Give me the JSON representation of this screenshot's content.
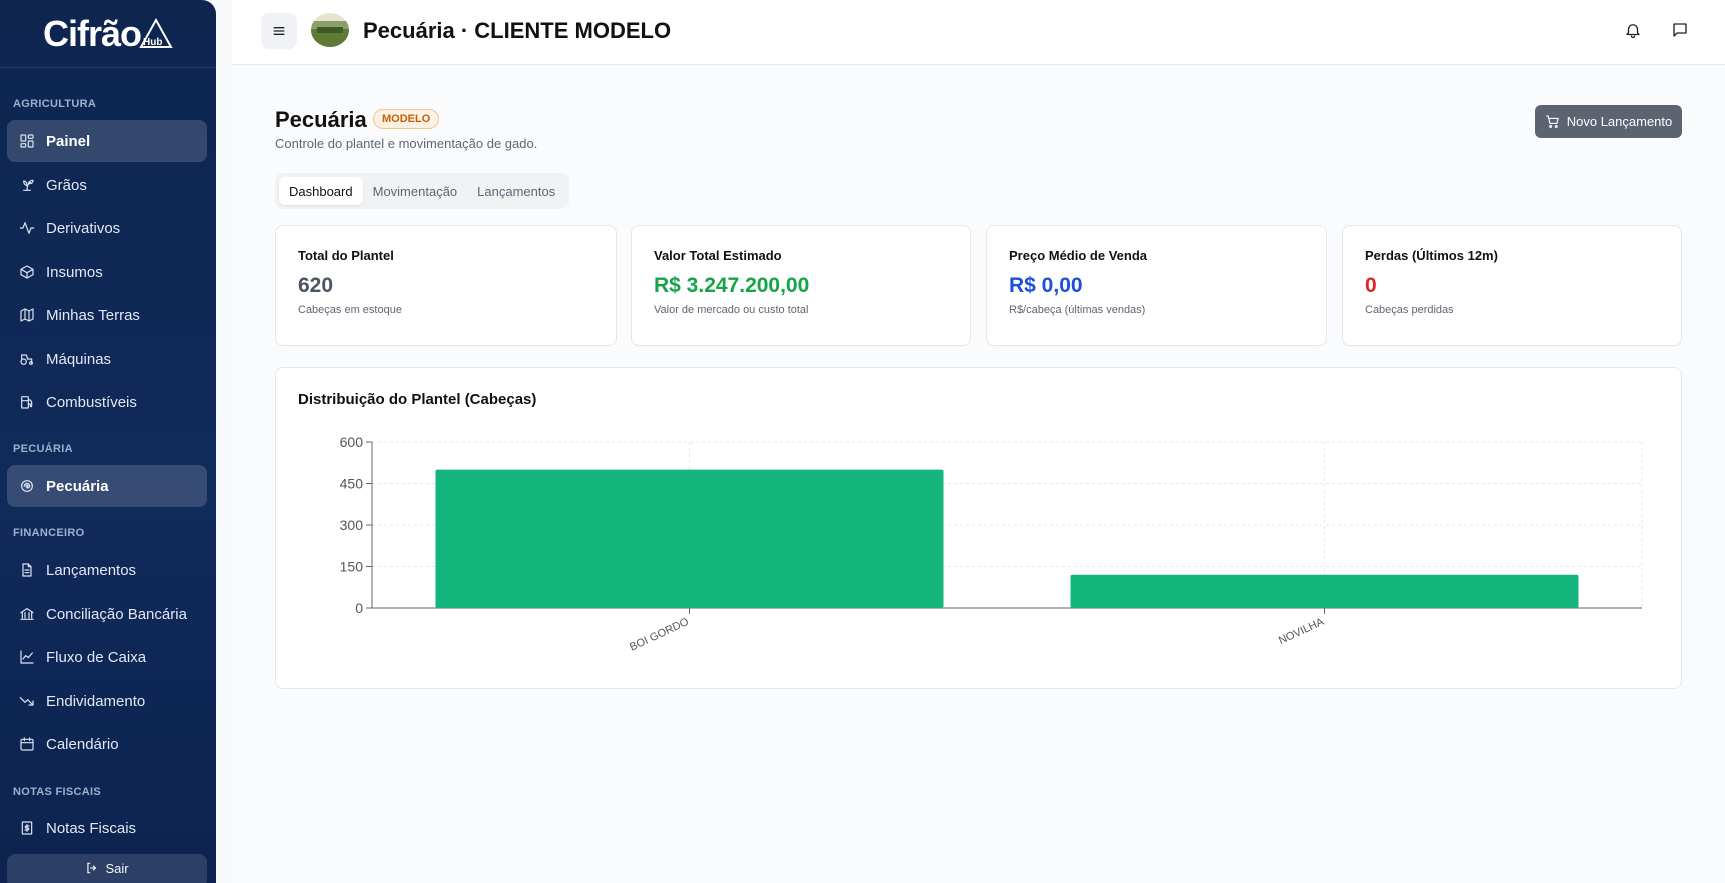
{
  "app": {
    "logo_text": "Cifrão",
    "logo_sub": "Hub"
  },
  "sidebar": {
    "sections": [
      {
        "label": "AGRICULTURA"
      },
      {
        "label": "PECUÁRIA"
      },
      {
        "label": "FINANCEIRO"
      },
      {
        "label": "NOTAS FISCAIS"
      }
    ],
    "items": [
      {
        "label": "Painel",
        "icon": "dashboard-icon",
        "active": true
      },
      {
        "label": "Grãos",
        "icon": "sprout-icon"
      },
      {
        "label": "Derivativos",
        "icon": "activity-icon"
      },
      {
        "label": "Insumos",
        "icon": "box-icon"
      },
      {
        "label": "Minhas Terras",
        "icon": "map-icon"
      },
      {
        "label": "Máquinas",
        "icon": "tractor-icon"
      },
      {
        "label": "Combustíveis",
        "icon": "fuel-icon"
      },
      {
        "label": "Pecuária",
        "icon": "cattle-icon",
        "active": true
      },
      {
        "label": "Lançamentos",
        "icon": "file-icon"
      },
      {
        "label": "Conciliação Bancária",
        "icon": "bank-icon"
      },
      {
        "label": "Fluxo de Caixa",
        "icon": "line-chart-icon"
      },
      {
        "label": "Endividamento",
        "icon": "trending-down-icon"
      },
      {
        "label": "Calendário",
        "icon": "calendar-icon"
      },
      {
        "label": "Notas Fiscais",
        "icon": "receipt-icon"
      }
    ],
    "logout_label": "Sair"
  },
  "header": {
    "title": "Pecuária · CLIENTE MODELO"
  },
  "page": {
    "title": "Pecuária",
    "badge": "MODELO",
    "subtitle": "Controle do plantel e movimentação de gado.",
    "new_button": "Novo Lançamento",
    "tabs": [
      {
        "label": "Dashboard",
        "active": true
      },
      {
        "label": "Movimentação"
      },
      {
        "label": "Lançamentos"
      }
    ],
    "cards": [
      {
        "title": "Total do Plantel",
        "value": "620",
        "sub": "Cabeças em estoque",
        "color": "#4b5563"
      },
      {
        "title": "Valor Total Estimado",
        "value": "R$ 3.247.200,00",
        "sub": "Valor de mercado ou custo total",
        "color": "#16a34a"
      },
      {
        "title": "Preço Médio de Venda",
        "value": "R$ 0,00",
        "sub": "R$/cabeça (últimas vendas)",
        "color": "#1d4ed8"
      },
      {
        "title": "Perdas (Últimos 12m)",
        "value": "0",
        "sub": "Cabeças perdidas",
        "color": "#dc2626"
      }
    ]
  },
  "chart_data": {
    "type": "bar",
    "title": "Distribuição do Plantel (Cabeças)",
    "categories": [
      "BOI GORDO",
      "NOVILHA"
    ],
    "values": [
      500,
      120
    ],
    "yticks": [
      0,
      150,
      300,
      450,
      600
    ],
    "ylim": [
      0,
      600
    ],
    "bar_color": "#15b67e",
    "grid": true
  }
}
